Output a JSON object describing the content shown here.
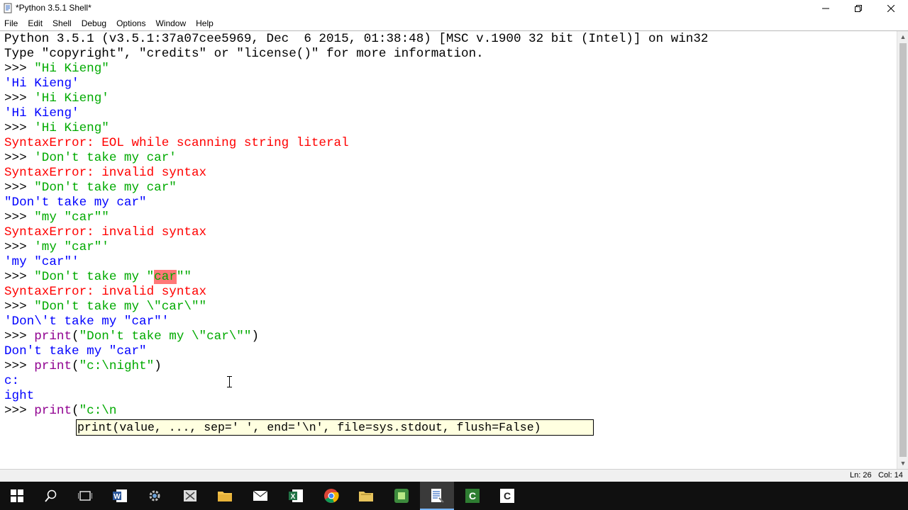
{
  "window": {
    "title": "*Python 3.5.1 Shell*",
    "minimize_glyph": "—",
    "maximize_glyph": "❐",
    "close_glyph": "✕"
  },
  "menu": [
    "File",
    "Edit",
    "Shell",
    "Debug",
    "Options",
    "Window",
    "Help"
  ],
  "shell": {
    "banner1": "Python 3.5.1 (v3.5.1:37a07cee5969, Dec  6 2015, 01:38:48) [MSC v.1900 32 bit (Intel)] on win32",
    "banner2": "Type \"copyright\", \"credits\" or \"license()\" for more information.",
    "prompt": ">>> ",
    "l3": "\"Hi Kieng\"",
    "l4": "'Hi Kieng'",
    "l5": "'Hi Kieng'",
    "l6": "'Hi Kieng'",
    "l7": "'Hi Kieng\"",
    "l8": "SyntaxError: EOL while scanning string literal",
    "l9": "'Don't take my car'",
    "l10": "SyntaxError: invalid syntax",
    "l11": "\"Don't take my car\"",
    "l12": "\"Don't take my car\"",
    "l13": "\"my \"car\"\"",
    "l14": "SyntaxError: invalid syntax",
    "l15": "'my \"car\"'",
    "l16": "'my \"car\"'",
    "l17a": "\"Don't take my \"",
    "l17b": "car",
    "l17c": "\"\"",
    "l18": "SyntaxError: invalid syntax",
    "l19": "\"Don't take my \\\"car\\\"\"",
    "l20": "'Don\\'t take my \"car\"'",
    "l21a": "print",
    "l21b": "(",
    "l21c": "\"Don't take my \\\"car\\\"\"",
    "l21d": ")",
    "l22": "Don't take my \"car\"",
    "l23a": "print",
    "l23b": "(",
    "l23c": "\"c:\\night\"",
    "l23d": ")",
    "l24": "c:",
    "l25": "ight",
    "l26a": "print",
    "l26b": "(",
    "l26c": "\"c:\\n"
  },
  "calltip": "print(value, ..., sep=' ', end='\\n', file=sys.stdout, flush=False)",
  "status": {
    "line": "Ln: 26",
    "col": "Col: 14"
  },
  "taskbar": {
    "items": [
      "windows-start",
      "search",
      "task-view",
      "word",
      "settings-tool",
      "snipping-tool",
      "file-explorer",
      "mail",
      "excel",
      "chrome",
      "folder-app",
      "camtasia",
      "python-idle",
      "codeblocks-c",
      "c-app"
    ],
    "active": "python-idle"
  },
  "colors": {
    "string": "#00aa00",
    "result": "#0000ff",
    "error": "#ff0000",
    "builtin": "#900090",
    "highlight": "#ff7777",
    "calltip_bg": "#ffffe0",
    "taskbar": "#101010"
  }
}
